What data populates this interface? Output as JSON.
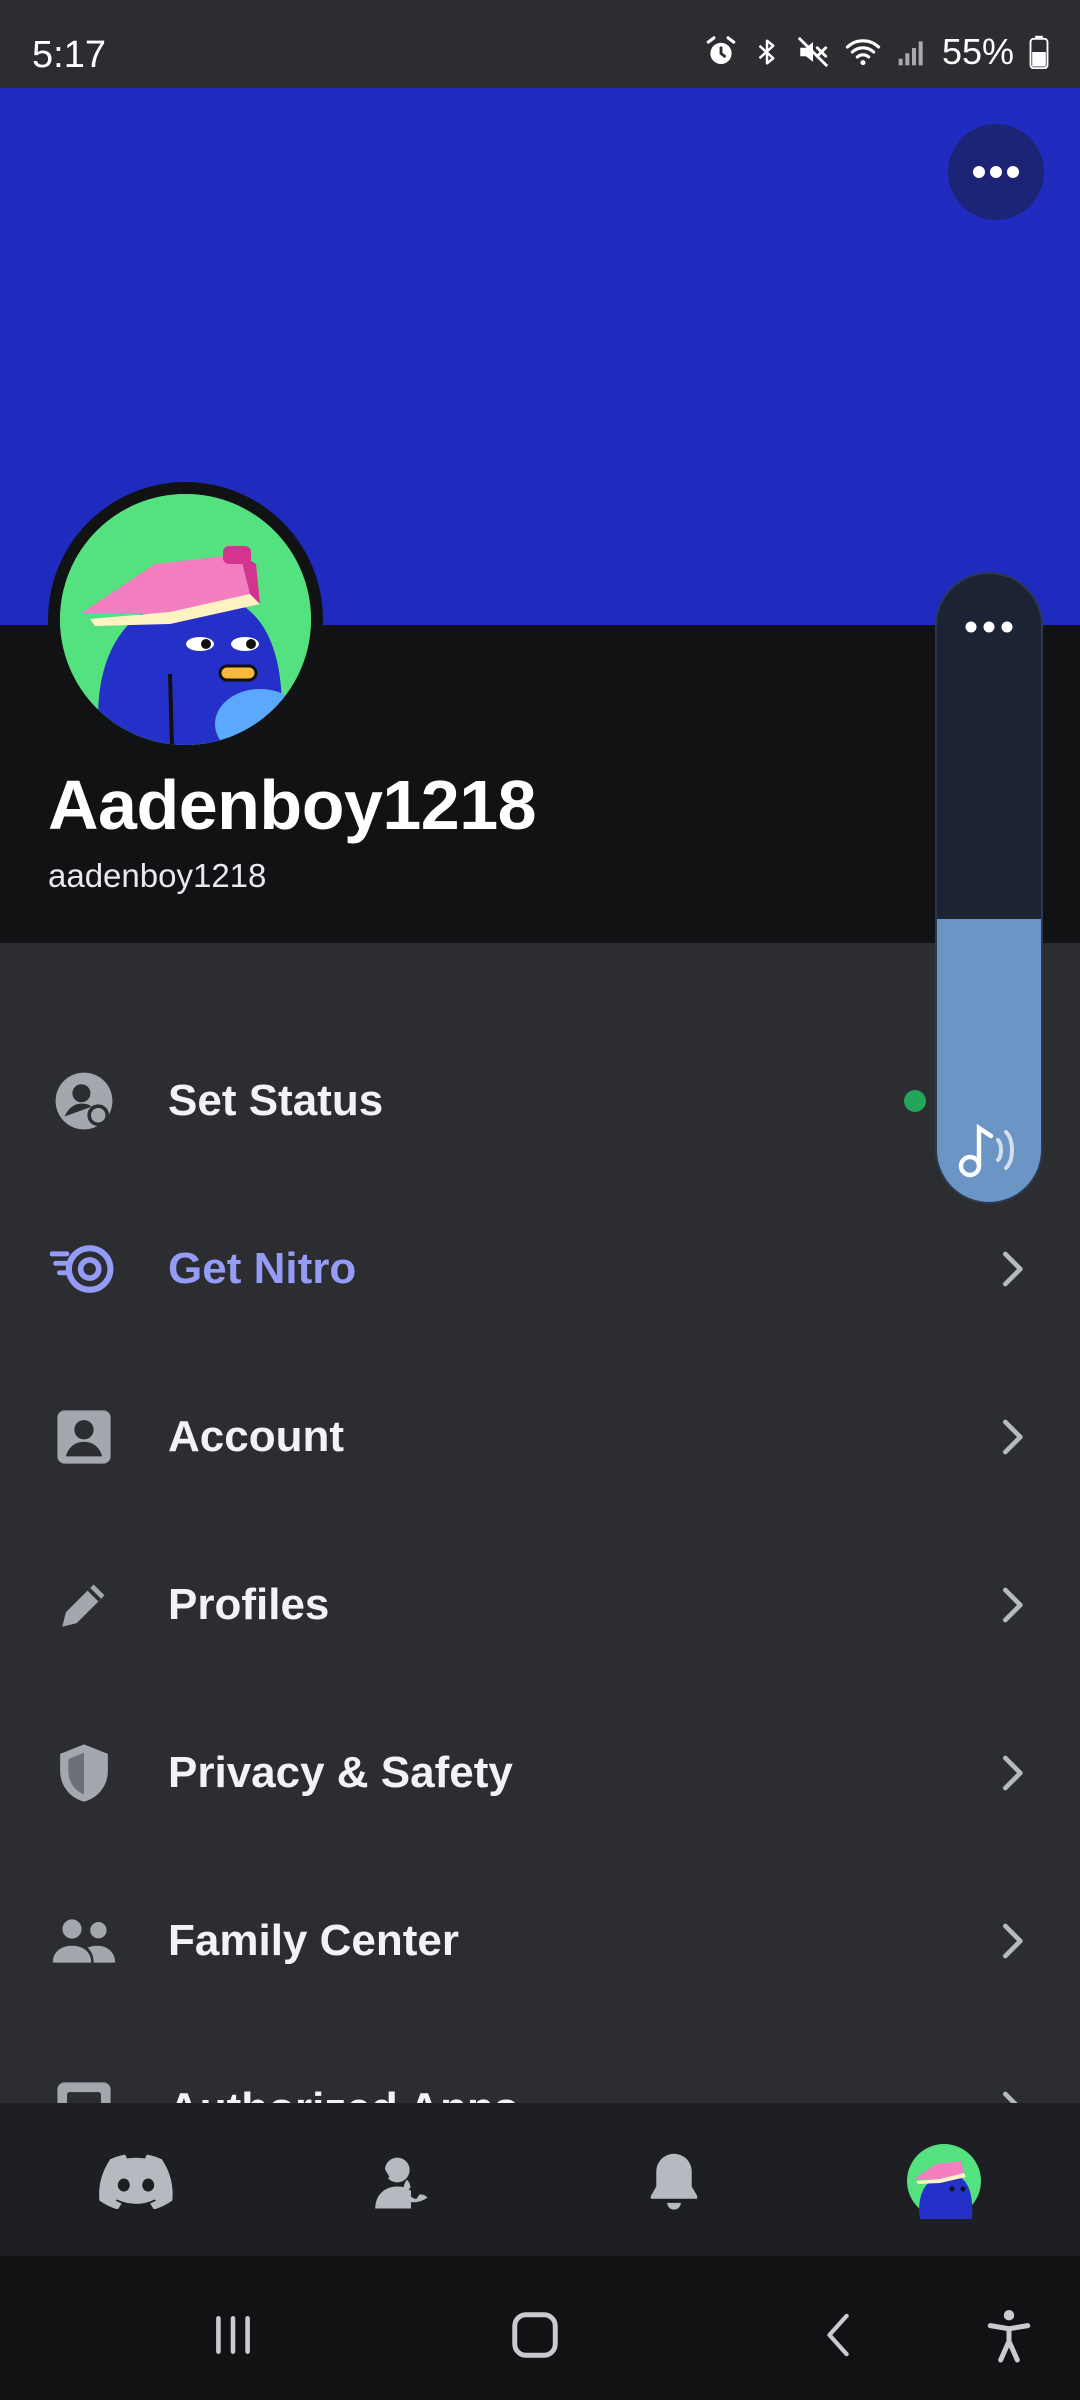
{
  "status_bar": {
    "time": "5:17",
    "battery": "55%",
    "icons": [
      "alarm-icon",
      "bluetooth-icon",
      "mute-icon",
      "wifi-icon",
      "signal-icon",
      "battery-icon"
    ]
  },
  "profile": {
    "display_name": "Aadenboy1218",
    "username": "aadenboy1218",
    "banner_color": "#1f2bbe"
  },
  "menu": {
    "items": [
      {
        "label": "Set Status",
        "icon": "user-status-icon"
      },
      {
        "label": "Get Nitro",
        "icon": "nitro-icon"
      },
      {
        "label": "Account",
        "icon": "account-icon"
      },
      {
        "label": "Profiles",
        "icon": "pencil-icon"
      },
      {
        "label": "Privacy & Safety",
        "icon": "shield-icon"
      },
      {
        "label": "Family Center",
        "icon": "family-icon"
      },
      {
        "label": "Authorized Apps",
        "icon": "apps-icon"
      }
    ]
  },
  "volume_overlay": {
    "level_percent": 45,
    "icon": "music-volume-icon"
  },
  "bottom_nav": {
    "items": [
      "discord-home-icon",
      "friends-icon",
      "notifications-icon",
      "profile-avatar-icon"
    ]
  },
  "system_nav": {
    "items": [
      "recents-icon",
      "home-icon",
      "back-icon",
      "accessibility-icon"
    ]
  },
  "colors": {
    "accent_nitro": "#949cf7",
    "online": "#23a55a",
    "background": "#2b2d31"
  }
}
